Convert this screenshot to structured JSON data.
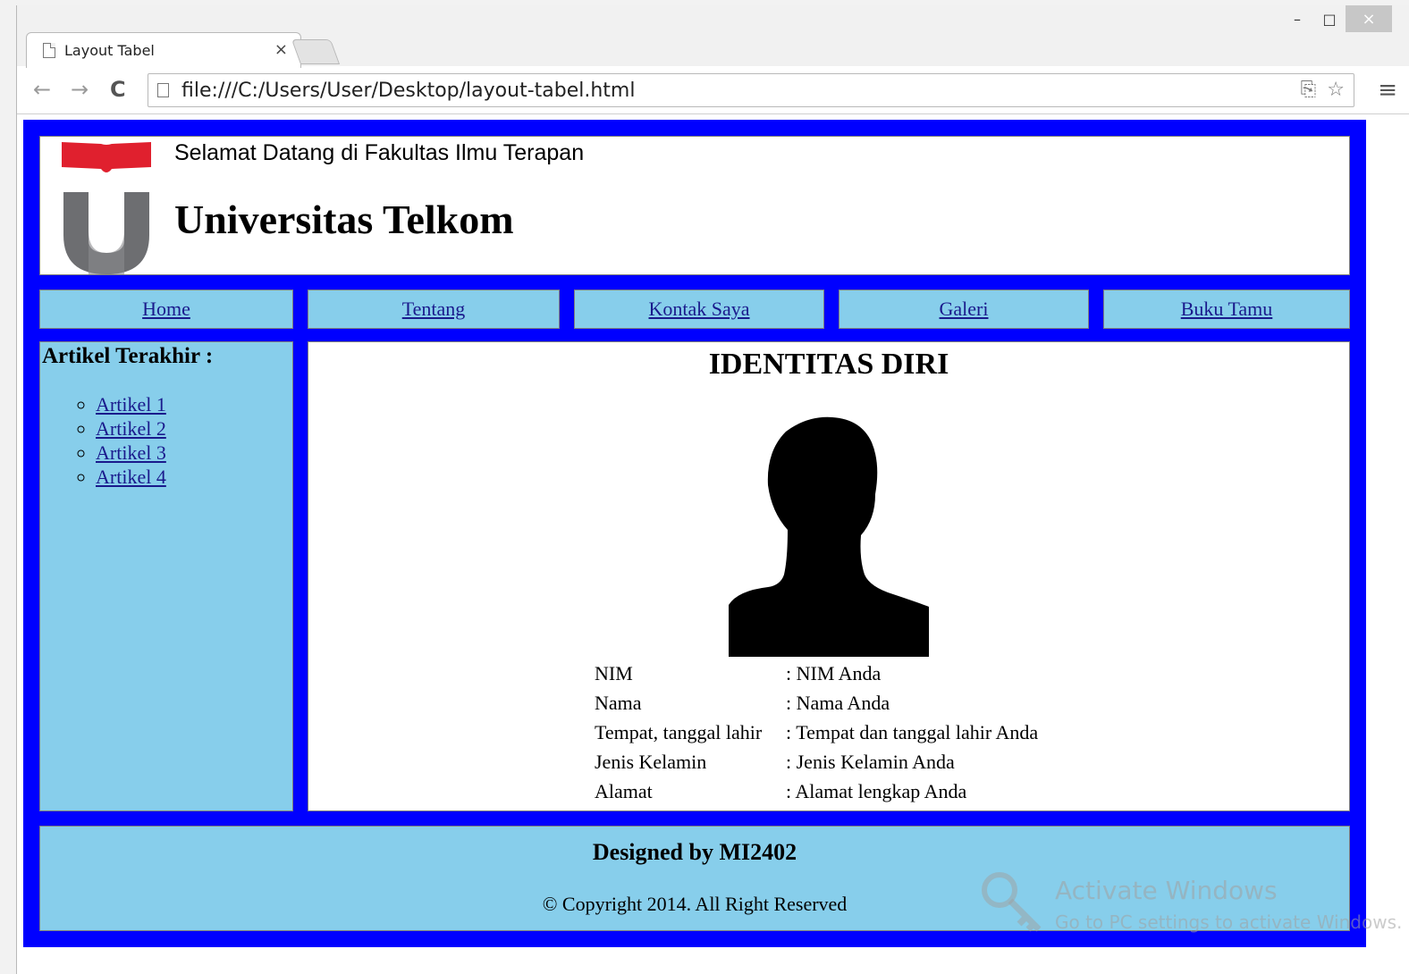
{
  "browser": {
    "tab_title": "Layout Tabel",
    "tab_close": "×",
    "url": "file:///C:/Users/User/Desktop/layout-tabel.html",
    "back_icon": "←",
    "forward_icon": "→",
    "reload_icon": "C",
    "menu_icon": "≡",
    "star_icon": "☆",
    "translate_icon": "⎘",
    "minimize": "–",
    "maximize": "□",
    "close": "×"
  },
  "header": {
    "welcome": "Selamat Datang di Fakultas Ilmu Terapan",
    "university": "Universitas Telkom",
    "logo_colors": {
      "red": "#e0202e",
      "gray": "#6d6e71"
    }
  },
  "menu": {
    "items": [
      {
        "label": "Home"
      },
      {
        "label": "Tentang"
      },
      {
        "label": "Kontak Saya"
      },
      {
        "label": "Galeri"
      },
      {
        "label": "Buku Tamu"
      }
    ]
  },
  "sidebar": {
    "title": "Artikel Terakhir :",
    "articles": [
      {
        "label": "Artikel 1"
      },
      {
        "label": "Artikel 2"
      },
      {
        "label": "Artikel 3"
      },
      {
        "label": "Artikel 4"
      }
    ]
  },
  "content": {
    "title": "IDENTITAS DIRI",
    "rows": [
      {
        "key": "NIM",
        "value": ": NIM Anda"
      },
      {
        "key": "Nama",
        "value": ": Nama Anda"
      },
      {
        "key": "Tempat, tanggal lahir",
        "value": ": Tempat dan tanggal lahir Anda"
      },
      {
        "key": "Jenis Kelamin",
        "value": ": Jenis Kelamin Anda"
      },
      {
        "key": "Alamat",
        "value": ": Alamat lengkap Anda"
      }
    ]
  },
  "footer": {
    "designed": "Designed by MI2402",
    "copyright": "© Copyright 2014. All Right Reserved"
  },
  "watermark": {
    "title": "Activate Windows",
    "subtitle": "Go to PC settings to activate Windows."
  },
  "colors": {
    "frame_blue": "#0000ff",
    "panel_sky": "#87ceeb",
    "link": "#1a1a8c"
  }
}
